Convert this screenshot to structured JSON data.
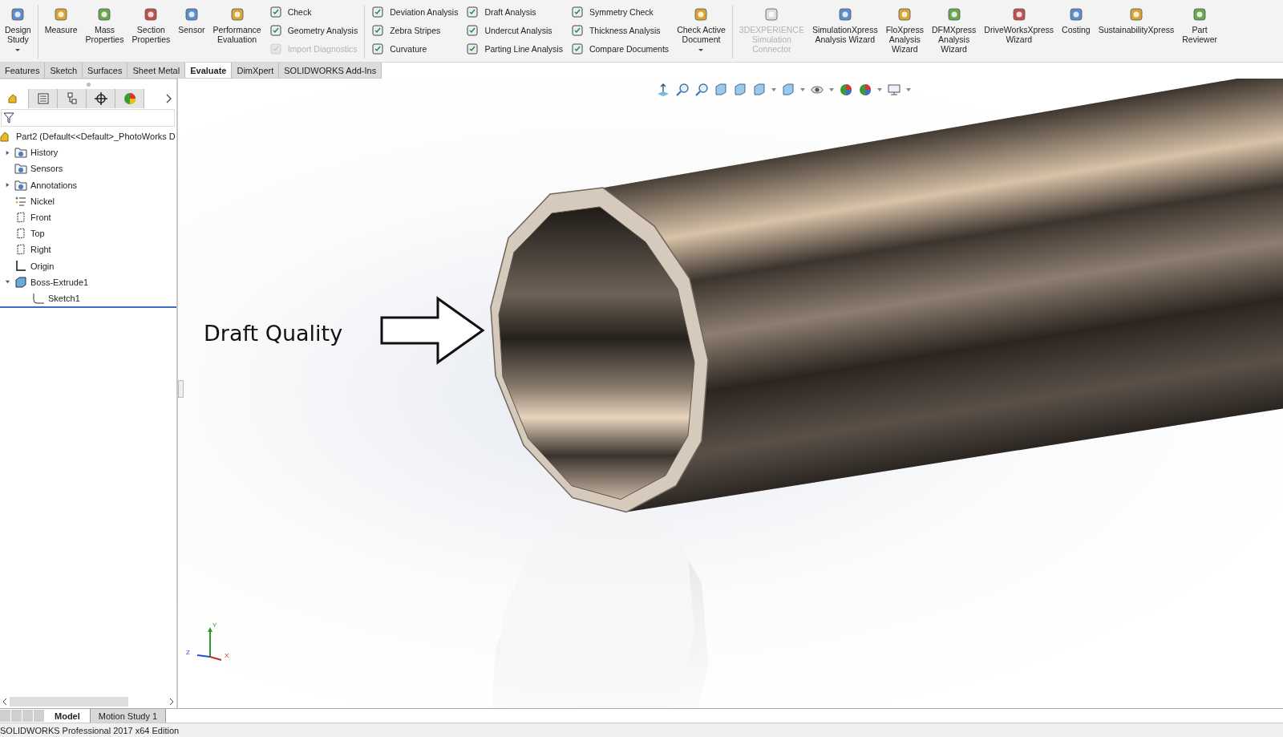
{
  "ribbon": {
    "groups": [
      {
        "items": [
          {
            "kind": "large",
            "label": "Design\nStudy",
            "disabled": false,
            "dropdown": true
          }
        ]
      },
      {
        "items": [
          {
            "kind": "large",
            "label": "Measure",
            "disabled": false,
            "dropdown": false
          },
          {
            "kind": "large",
            "label": "Mass\nProperties",
            "disabled": false,
            "dropdown": false
          },
          {
            "kind": "large",
            "label": "Section\nProperties",
            "disabled": false,
            "dropdown": false
          },
          {
            "kind": "large",
            "label": "Sensor",
            "disabled": false,
            "dropdown": false
          },
          {
            "kind": "large",
            "label": "Performance\nEvaluation",
            "disabled": false,
            "dropdown": false
          },
          {
            "kind": "stack",
            "items": [
              {
                "label": "Check",
                "disabled": false
              },
              {
                "label": "Geometry Analysis",
                "disabled": false
              },
              {
                "label": "Import Diagnostics",
                "disabled": true
              }
            ]
          }
        ]
      },
      {
        "items": [
          {
            "kind": "stack",
            "items": [
              {
                "label": "Deviation Analysis",
                "disabled": false
              },
              {
                "label": "Zebra Stripes",
                "disabled": false
              },
              {
                "label": "Curvature",
                "disabled": false
              }
            ]
          },
          {
            "kind": "stack",
            "items": [
              {
                "label": "Draft Analysis",
                "disabled": false
              },
              {
                "label": "Undercut Analysis",
                "disabled": false
              },
              {
                "label": "Parting Line Analysis",
                "disabled": false
              }
            ]
          },
          {
            "kind": "stack",
            "items": [
              {
                "label": "Symmetry Check",
                "disabled": false
              },
              {
                "label": "Thickness Analysis",
                "disabled": false
              },
              {
                "label": "Compare Documents",
                "disabled": false
              }
            ]
          },
          {
            "kind": "large",
            "label": "Check Active\nDocument",
            "disabled": false,
            "dropdown": true
          }
        ]
      },
      {
        "items": [
          {
            "kind": "large",
            "label": "3DEXPERIENCE\nSimulation\nConnector",
            "disabled": true,
            "dropdown": false
          },
          {
            "kind": "large",
            "label": "SimulationXpress\nAnalysis Wizard",
            "disabled": false,
            "dropdown": false
          },
          {
            "kind": "large",
            "label": "FloXpress\nAnalysis\nWizard",
            "disabled": false,
            "dropdown": false
          },
          {
            "kind": "large",
            "label": "DFMXpress\nAnalysis\nWizard",
            "disabled": false,
            "dropdown": false
          },
          {
            "kind": "large",
            "label": "DriveWorksXpress\nWizard",
            "disabled": false,
            "dropdown": false
          },
          {
            "kind": "large",
            "label": "Costing",
            "disabled": false,
            "dropdown": false
          },
          {
            "kind": "large",
            "label": "SustainabilityXpress",
            "disabled": false,
            "dropdown": false
          },
          {
            "kind": "large",
            "label": "Part\nReviewer",
            "disabled": false,
            "dropdown": false
          }
        ]
      }
    ]
  },
  "tabs": [
    {
      "label": "Features",
      "selected": false
    },
    {
      "label": "Sketch",
      "selected": false
    },
    {
      "label": "Surfaces",
      "selected": false
    },
    {
      "label": "Sheet Metal",
      "selected": false
    },
    {
      "label": "Evaluate",
      "selected": true
    },
    {
      "label": "DimXpert",
      "selected": false
    },
    {
      "label": "SOLIDWORKS Add-Ins",
      "selected": false
    }
  ],
  "view_toolbar": [
    {
      "dropdown": false
    },
    {
      "dropdown": false
    },
    {
      "dropdown": false
    },
    {
      "dropdown": false
    },
    {
      "dropdown": false
    },
    {
      "dropdown": true
    },
    {
      "dropdown": true
    },
    {
      "dropdown": true
    },
    {
      "dropdown": false
    },
    {
      "dropdown": true
    },
    {
      "dropdown": true
    }
  ],
  "panel_tabs": [
    {
      "selected": true
    },
    {
      "selected": false
    },
    {
      "selected": false
    },
    {
      "selected": false
    },
    {
      "selected": false
    }
  ],
  "tree": {
    "root": "Part2  (Default<<Default>_PhotoWorks D",
    "items": [
      {
        "kind": "folder",
        "label": "History",
        "expanded": false
      },
      {
        "kind": "folder",
        "label": "Sensors"
      },
      {
        "kind": "folder",
        "label": "Annotations",
        "expanded": false
      },
      {
        "kind": "appearance",
        "label": "Nickel"
      },
      {
        "kind": "plane",
        "label": "Front"
      },
      {
        "kind": "plane",
        "label": "Top"
      },
      {
        "kind": "plane",
        "label": "Right"
      },
      {
        "kind": "origin",
        "label": "Origin"
      },
      {
        "kind": "feature",
        "label": "Boss-Extrude1",
        "expanded": true,
        "children": [
          {
            "kind": "sketch",
            "label": "Sketch1"
          }
        ]
      }
    ]
  },
  "viewport": {
    "annotation": "Draft Quality",
    "triad": {
      "y": "Y",
      "z": "Z",
      "x": "X"
    }
  },
  "bottom_tabs": [
    {
      "label": "Model",
      "selected": true
    },
    {
      "label": "Motion Study 1",
      "selected": false
    }
  ],
  "status_bar": "SOLIDWORKS Professional 2017 x64 Edition"
}
